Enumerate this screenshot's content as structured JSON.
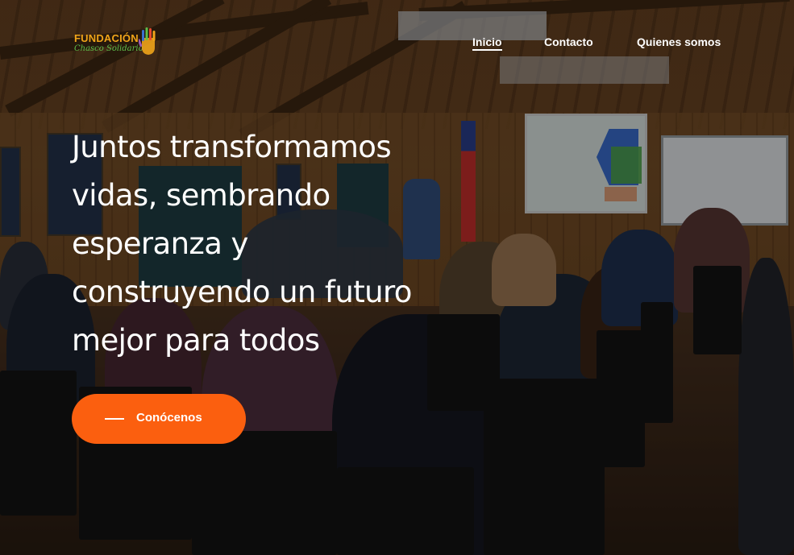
{
  "brand": {
    "name_top": "FUNDACIÓN",
    "name_bottom": "Chasco Solidario",
    "icon": "hand-icon",
    "colors": {
      "orange": "#f0a419",
      "green": "#5fbf4a",
      "blue": "#3a6fd0"
    }
  },
  "nav": {
    "items": [
      {
        "label": "Inicio",
        "active": true
      },
      {
        "label": "Contacto",
        "active": false
      },
      {
        "label": "Quienes somos",
        "active": false
      }
    ]
  },
  "hero": {
    "headline_lines": [
      "Juntos transformamos",
      "vidas, sembrando",
      "esperanza y",
      "construyendo un futuro",
      "mejor para todos"
    ],
    "background_scene": "photo-of-meeting-room",
    "cta": {
      "label": "Conócenos",
      "color": "#fb5f0f"
    }
  }
}
